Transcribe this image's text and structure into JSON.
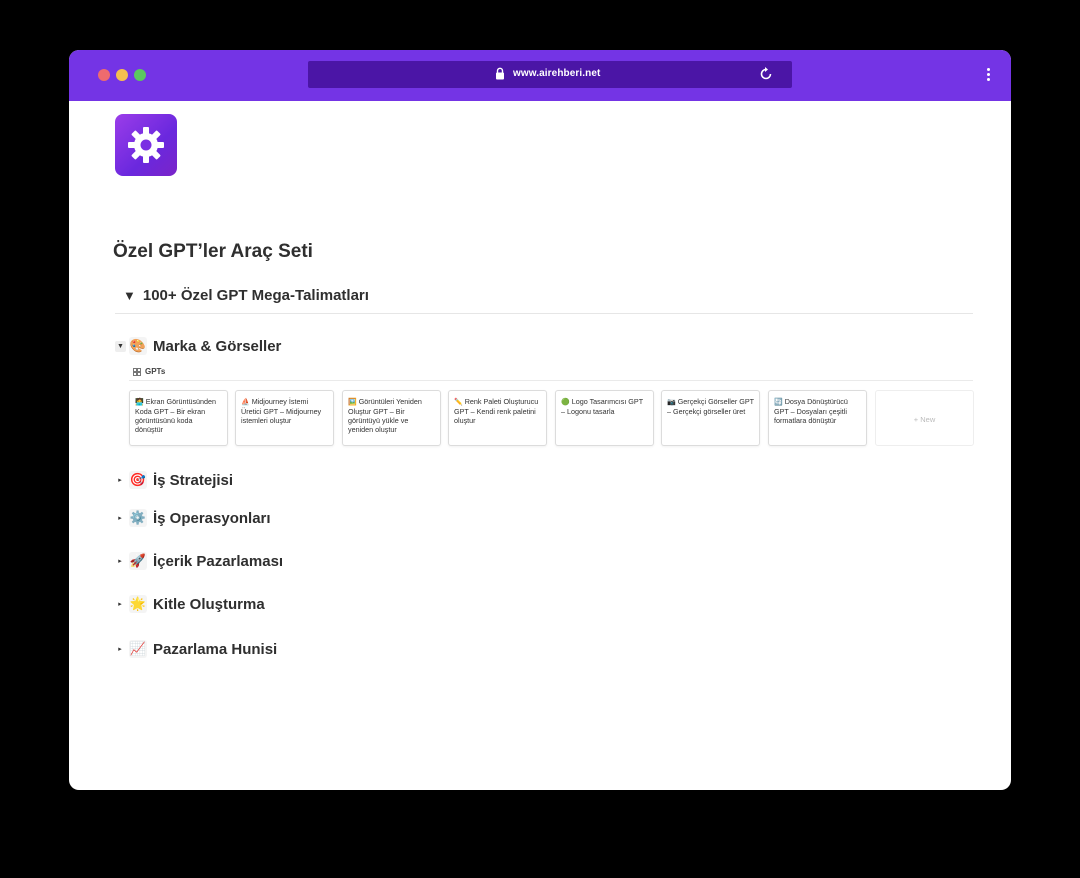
{
  "browser": {
    "url": "www.airehberi.net"
  },
  "page": {
    "title": "Özel GPT’ler Araç Seti",
    "toggle_heading": "100+ Özel GPT Mega-Talimatları",
    "toggle_symbol": "▼"
  },
  "sections": [
    {
      "label": "Marka & Görseller",
      "emoji": "🎨",
      "arrow": "▼",
      "expanded": true
    },
    {
      "label": "İş Stratejisi",
      "emoji": "🎯",
      "arrow": "▸",
      "expanded": false
    },
    {
      "label": "İş Operasyonları",
      "emoji": "⚙️",
      "arrow": "▸",
      "expanded": false
    },
    {
      "label": "İçerik Pazarlaması",
      "emoji": "🚀",
      "arrow": "▸",
      "expanded": false
    },
    {
      "label": "Kitle Oluşturma",
      "emoji": "🌟",
      "arrow": "▸",
      "expanded": false
    },
    {
      "label": "Pazarlama Hunisi",
      "emoji": "📈",
      "arrow": "▸",
      "expanded": false
    }
  ],
  "database": {
    "label": "GPTs",
    "cards": [
      {
        "emoji": "🧑‍💻",
        "text": "Ekran Görüntüsünden Koda GPT – Bir ekran görüntüsünü koda dönüştür"
      },
      {
        "emoji": "⛵",
        "text": "Midjourney İstemi Üretici GPT – Midjourney istemleri oluştur"
      },
      {
        "emoji": "🖼️",
        "text": "Görüntüleri Yeniden Oluştur GPT – Bir görüntüyü yükle ve yeniden oluştur"
      },
      {
        "emoji": "✏️",
        "text": "Renk Paleti Oluşturucu GPT – Kendi renk paletini oluştur"
      },
      {
        "emoji": "🟢",
        "text": "Logo Tasarımcısı GPT – Logonu tasarla"
      },
      {
        "emoji": "📷",
        "text": "Gerçekçi Görseller GPT – Gerçekçi görseller üret"
      },
      {
        "emoji": "🔄",
        "text": "Dosya Dönüştürücü GPT – Dosyaları çeşitli formatlara dönüştür"
      }
    ],
    "new_label": "+ New"
  }
}
